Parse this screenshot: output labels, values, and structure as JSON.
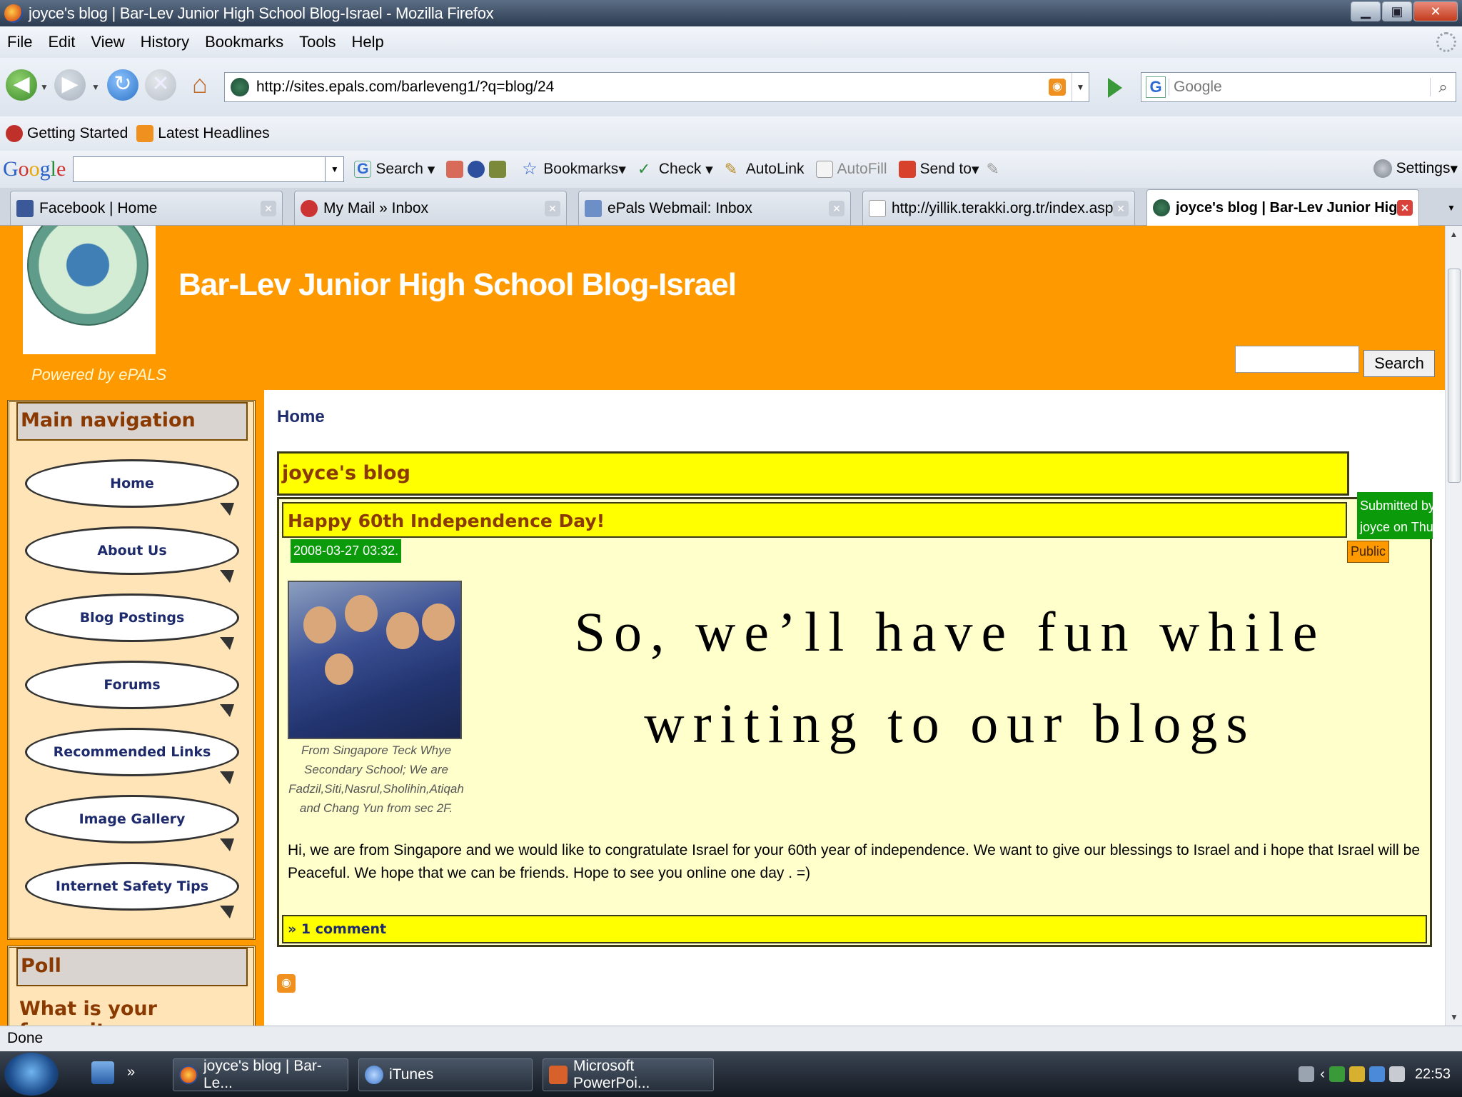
{
  "window": {
    "title": "joyce's blog | Bar-Lev Junior High School Blog-Israel - Mozilla Firefox",
    "buttons": {
      "minimize": "▁",
      "maximize": "▣",
      "close": "✕"
    }
  },
  "menu": [
    "File",
    "Edit",
    "View",
    "History",
    "Bookmarks",
    "Tools",
    "Help"
  ],
  "navbar": {
    "url": "http://sites.epals.com/barleveng1/?q=blog/24",
    "search_placeholder": "Google"
  },
  "bookmarks": [
    "Getting Started",
    "Latest Headlines"
  ],
  "google_toolbar": {
    "logo": [
      "G",
      "o",
      "o",
      "g",
      "l",
      "e"
    ],
    "items": [
      "Search",
      "Bookmarks",
      "Check",
      "AutoLink",
      "AutoFill",
      "Send to"
    ],
    "settings": "Settings"
  },
  "tabs": [
    {
      "label": "Facebook | Home",
      "active": false
    },
    {
      "label": "My Mail » Inbox",
      "active": false
    },
    {
      "label": "ePals Webmail: Inbox",
      "active": false
    },
    {
      "label": "http://yillik.terakki.org.tr/index.aspx",
      "active": false
    },
    {
      "label": "joyce's blog | Bar-Lev Junior High...",
      "active": true
    }
  ],
  "site": {
    "title": "Bar-Lev Junior High School Blog-Israel",
    "powered_by": "Powered by ePALS",
    "search_button": "Search"
  },
  "sidebar": {
    "main_nav_title": "Main navigation",
    "items": [
      "Home",
      "About Us",
      "Blog Postings",
      "Forums",
      "Recommended Links",
      "Image Gallery",
      "Internet Safety Tips"
    ],
    "poll_title": "Poll",
    "poll_question": "What is your favourite"
  },
  "content": {
    "breadcrumb": "Home",
    "blog_title": "joyce's blog",
    "post": {
      "title": "Happy 60th Independence Day!",
      "date": "2008-03-27 03:32.",
      "submitted": [
        "Submitted by",
        "joyce on Thu,"
      ],
      "badge": "Public",
      "caption": "From Singapore Teck Whye Secondary School; We are Fadzil,Siti,Nasrul,Sholihin,Atiqah and Chang Yun from sec 2F.",
      "overlay_text": "So, we’ll have fun while writing to our blogs",
      "body": "Hi, we are from Singapore and we would like to congratulate Israel for your 60th year of independence. We want to give our blessings to Israel and i hope that Israel will be Peaceful. We hope that we can be friends. Hope to see you online one day . =)",
      "comments": "» 1 comment"
    }
  },
  "status": "Done",
  "taskbar": {
    "tasks": [
      "joyce's blog | Bar-Le...",
      "iTunes",
      "Microsoft PowerPoi..."
    ],
    "clock": "22:53"
  },
  "colors": {
    "header_orange": "#ff9900",
    "bar_yellow": "#ffff00",
    "post_bg": "#ffffcc",
    "badge_green": "#0a9a0a",
    "title_brown": "#8a3a00",
    "nav_text": "#1d2a6b"
  }
}
